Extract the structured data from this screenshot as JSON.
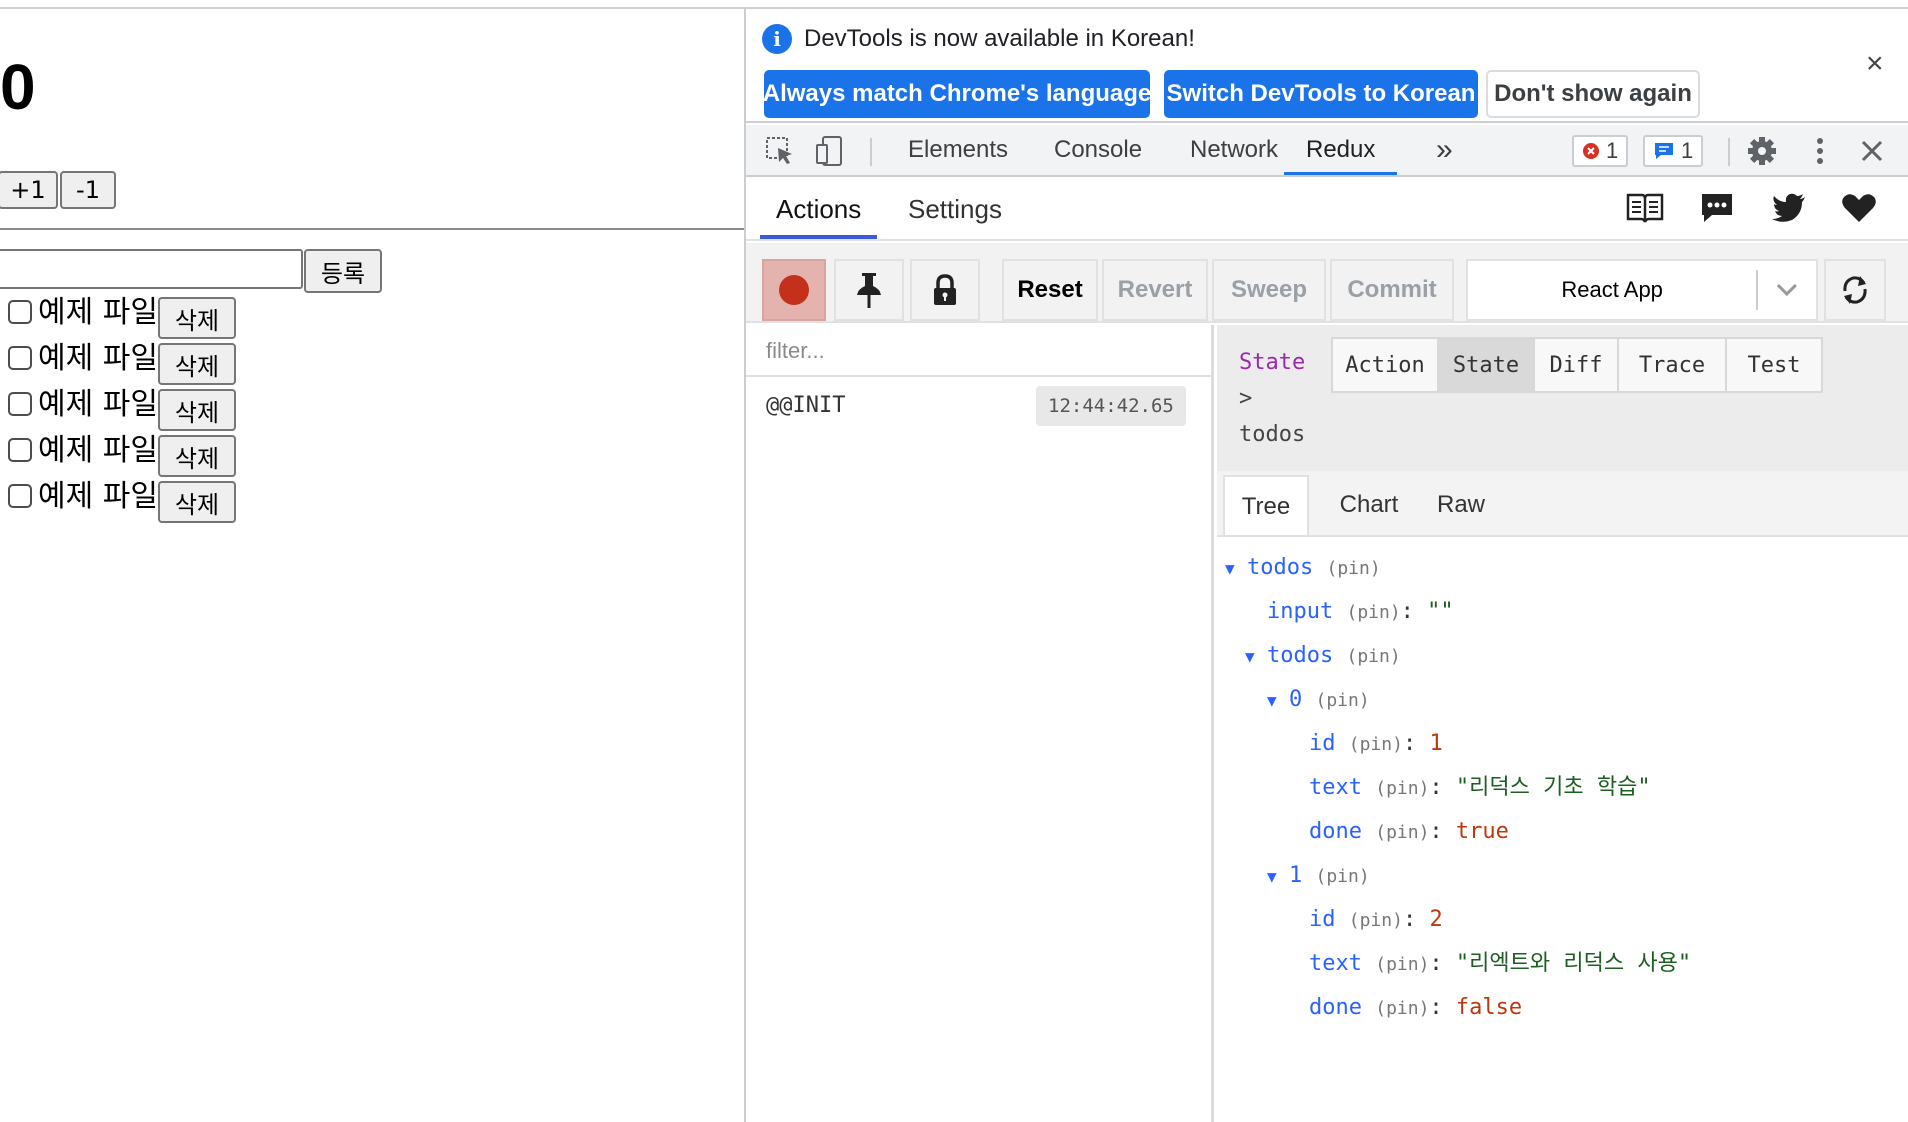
{
  "app": {
    "counter": "0",
    "inc_label": "+1",
    "dec_label": "-1",
    "input_value": "",
    "add_label": "등록",
    "todos": [
      {
        "text": "예제 파일",
        "delete_label": "삭제"
      },
      {
        "text": "예제 파일",
        "delete_label": "삭제"
      },
      {
        "text": "예제 파일",
        "delete_label": "삭제"
      },
      {
        "text": "예제 파일",
        "delete_label": "삭제"
      },
      {
        "text": "예제 파일",
        "delete_label": "삭제"
      }
    ]
  },
  "infobar": {
    "message": "DevTools is now available in Korean!",
    "btn_match": "Always match Chrome's language",
    "btn_switch": "Switch DevTools to Korean",
    "btn_dont": "Don't show again",
    "close": "×"
  },
  "toolbar": {
    "tabs": [
      "Elements",
      "Console",
      "Network",
      "Redux"
    ],
    "active_tab": "Redux",
    "more": "»",
    "errors_count": "1",
    "messages_count": "1"
  },
  "redux": {
    "tabs": [
      "Actions",
      "Settings"
    ],
    "controls": {
      "reset": "Reset",
      "revert": "Revert",
      "sweep": "Sweep",
      "commit": "Commit"
    },
    "instance": "React App",
    "filter_placeholder": "filter...",
    "actions": [
      {
        "name": "@@INIT",
        "time": "12:44:42.65"
      }
    ],
    "state_header": {
      "state_label": "State",
      "arrow": ">",
      "path": "todos"
    },
    "segments": [
      "Action",
      "State",
      "Diff",
      "Trace",
      "Test"
    ],
    "active_segment": "State",
    "subtabs": [
      "Tree",
      "Chart",
      "Raw"
    ],
    "tree": {
      "root": "todos",
      "pin": "(pin)",
      "input_key": "input",
      "input_val": "\"\"",
      "todos_key": "todos",
      "item0": {
        "index": "0",
        "id_key": "id",
        "id_val": "1",
        "text_key": "text",
        "text_val": "\"리덕스 기초 학습\"",
        "done_key": "done",
        "done_val": "true"
      },
      "item1": {
        "index": "1",
        "id_key": "id",
        "id_val": "2",
        "text_key": "text",
        "text_val": "\"리엑트와 리덕스 사용\"",
        "done_key": "done",
        "done_val": "false"
      }
    }
  },
  "colors": {
    "accent": "#1a73e8",
    "record": "#c4301c",
    "tree_key": "#2962ff",
    "tree_string": "#1b5e20",
    "tree_number": "#bf360c"
  }
}
